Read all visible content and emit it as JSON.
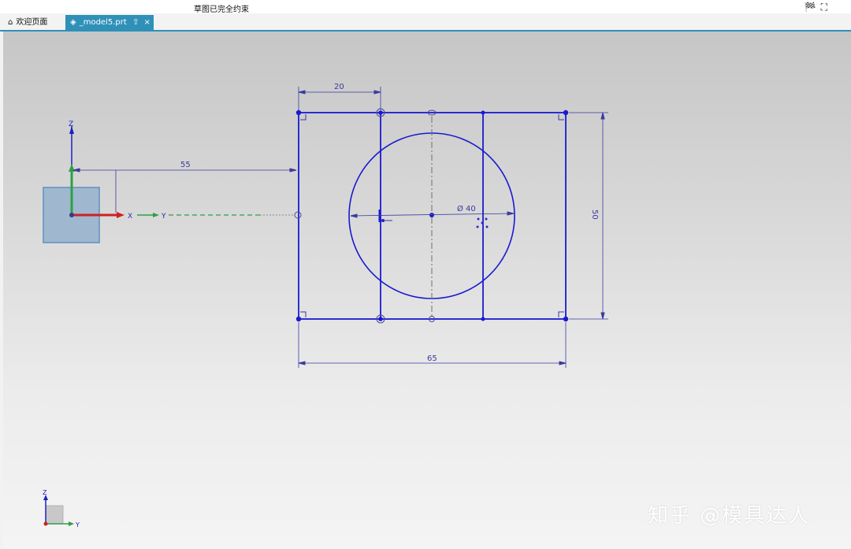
{
  "status": {
    "message": "草图已完全约束"
  },
  "tabs": [
    {
      "label": "欢迎页面",
      "icon": "home-icon"
    },
    {
      "label": "_model5.prt",
      "icon": "part-file-icon"
    }
  ],
  "window_icons": [
    "checkered-flag-icon",
    "fullscreen-icon"
  ],
  "sketch": {
    "dimensions": {
      "offset_x": "55",
      "width_top": "20",
      "height": "50",
      "width_bottom": "65",
      "diameter": "Ø 40"
    },
    "axis_labels": {
      "z": "Z",
      "x": "X",
      "y": "Y"
    }
  },
  "mini_triad": {
    "z": "Z",
    "y": "Y"
  },
  "watermark": "知乎 @模具达人",
  "colors": {
    "sketch_blue": "#1a1ad0",
    "dimension_blue": "#3a3aa0",
    "tab_accent": "#2f90b8",
    "axis_green": "#2ea043",
    "axis_red": "#d02020"
  }
}
